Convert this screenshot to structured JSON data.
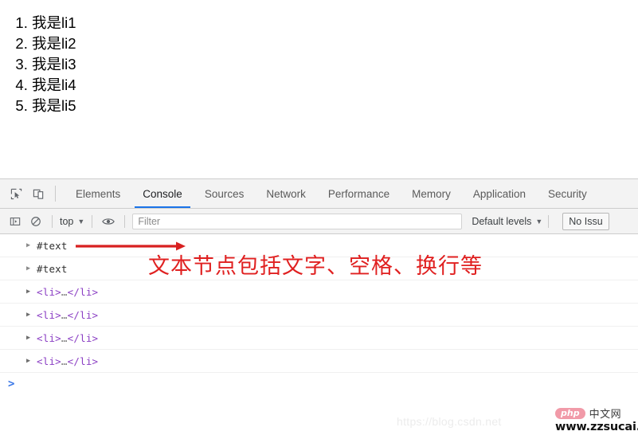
{
  "page": {
    "list_items": [
      "我是li1",
      "我是li2",
      "我是li3",
      "我是li4",
      "我是li5"
    ]
  },
  "devtools": {
    "icons": {
      "inspect": "inspect-element-icon",
      "device": "device-toolbar-icon"
    },
    "tabs": [
      {
        "label": "Elements",
        "active": false
      },
      {
        "label": "Console",
        "active": true
      },
      {
        "label": "Sources",
        "active": false
      },
      {
        "label": "Network",
        "active": false
      },
      {
        "label": "Performance",
        "active": false
      },
      {
        "label": "Memory",
        "active": false
      },
      {
        "label": "Application",
        "active": false
      },
      {
        "label": "Security",
        "active": false
      }
    ],
    "console_toolbar": {
      "sidebar_icon": "console-sidebar-icon",
      "clear_icon": "clear-console-icon",
      "context_label": "top",
      "context_caret": "▼",
      "eye_icon": "live-expression-eye-icon",
      "filter_placeholder": "Filter",
      "levels_label": "Default levels",
      "levels_caret": "▼",
      "issues_label": "No Issu"
    },
    "console_rows": [
      {
        "arrow": "▶",
        "kind": "text",
        "text": "#text"
      },
      {
        "arrow": "▶",
        "kind": "text",
        "text": "#text"
      },
      {
        "arrow": "▶",
        "kind": "element",
        "open": "<li>",
        "dots": "…",
        "close": "</li>"
      },
      {
        "arrow": "▶",
        "kind": "element",
        "open": "<li>",
        "dots": "…",
        "close": "</li>"
      },
      {
        "arrow": "▶",
        "kind": "element",
        "open": "<li>",
        "dots": "…",
        "close": "</li>"
      },
      {
        "arrow": "▶",
        "kind": "element",
        "open": "<li>",
        "dots": "…",
        "close": "</li>"
      }
    ],
    "prompt_chevron": ">"
  },
  "annotation": {
    "text": "文本节点包括文字、空格、换行等",
    "color": "#e02020",
    "arrow_name": "red-arrow-pointing-to-text-node"
  },
  "watermarks": {
    "csdn": "https://blog.csdn.net",
    "brand_badge": "php",
    "brand_cn": "中文网",
    "brand_url": "www.zzsucai.com"
  },
  "colors": {
    "accent": "#1a73e8",
    "annotation_red": "#e02020",
    "toolbar_bg": "#f3f3f3",
    "tag_bracket": "#8b3fc4",
    "tag_name": "#a52a2a"
  }
}
